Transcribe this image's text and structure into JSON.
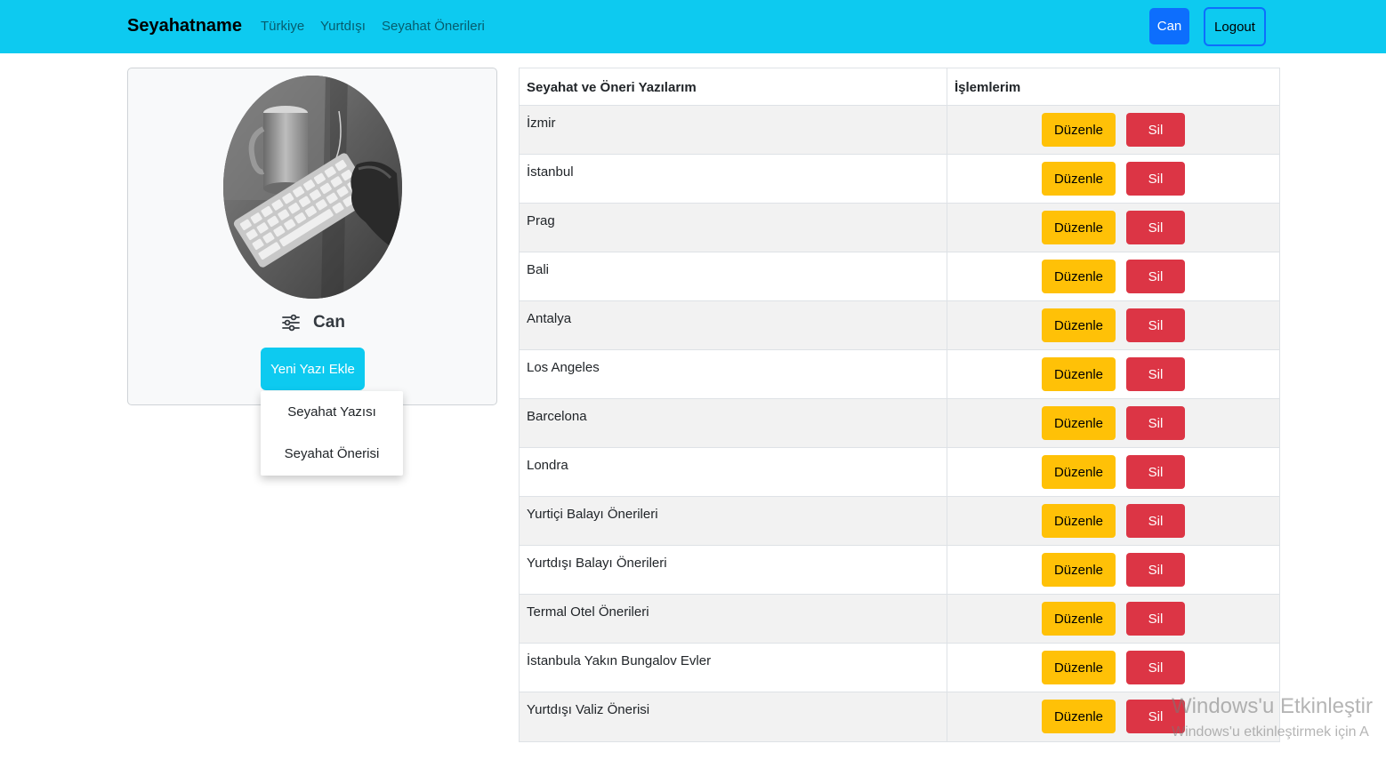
{
  "navbar": {
    "brand": "Seyahatname",
    "links": [
      "Türkiye",
      "Yurtdışı",
      "Seyahat Önerileri"
    ],
    "user_button": "Can",
    "logout_button": "Logout",
    "accent_color": "#0dcaf0"
  },
  "profile": {
    "name": "Can",
    "settings_icon": "sliders-icon",
    "add_button": "Yeni Yazı Ekle",
    "dropdown_items": [
      "Seyahat Yazısı",
      "Seyahat Önerisi"
    ]
  },
  "table": {
    "headers": [
      "Seyahat ve Öneri Yazılarım",
      "İşlemlerim"
    ],
    "edit_label": "Düzenle",
    "delete_label": "Sil",
    "rows": [
      "İzmir",
      "İstanbul",
      "Prag",
      "Bali",
      "Antalya",
      "Los Angeles",
      "Barcelona",
      "Londra",
      "Yurtiçi Balayı Önerileri",
      "Yurtdışı Balayı Önerileri",
      "Termal Otel Önerileri",
      "İstanbula Yakın Bungalov Evler",
      "Yurtdışı Valiz Önerisi"
    ]
  },
  "watermark": {
    "title": "Windows'u Etkinleştir",
    "subtitle": "Windows'u etkinleştirmek için A"
  }
}
